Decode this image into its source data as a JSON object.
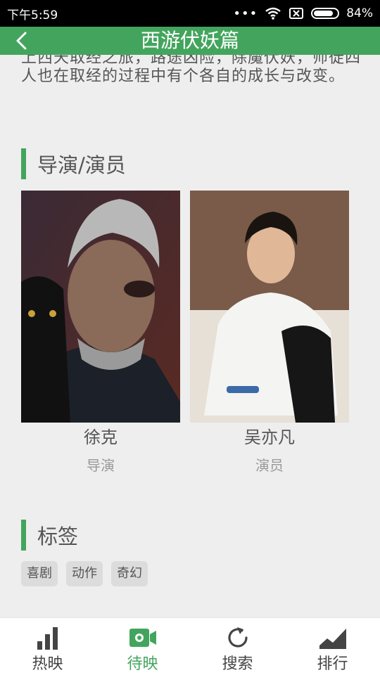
{
  "status": {
    "time": "下午5:59",
    "battery_pct": "84%",
    "battery_level": 0.84
  },
  "header": {
    "title": "西游伏妖篇"
  },
  "description": "上西天取经之旅，路途凶险，除魔伏妖，师徒四人也在取经的过程中有个各自的成长与改变。",
  "cast_section": {
    "title": "导演/演员",
    "people": [
      {
        "name": "徐克",
        "role": "导演"
      },
      {
        "name": "吴亦凡",
        "role": "演员"
      }
    ]
  },
  "tags_section": {
    "title": "标签",
    "tags": [
      "喜剧",
      "动作",
      "奇幻"
    ]
  },
  "tabbar": {
    "items": [
      {
        "label": "热映",
        "icon": "bar-chart-icon"
      },
      {
        "label": "待映",
        "icon": "camera-icon",
        "active": true
      },
      {
        "label": "搜索",
        "icon": "refresh-icon"
      },
      {
        "label": "排行",
        "icon": "ranking-icon"
      }
    ]
  },
  "colors": {
    "accent": "#43a55d",
    "background": "#eeeeee"
  }
}
